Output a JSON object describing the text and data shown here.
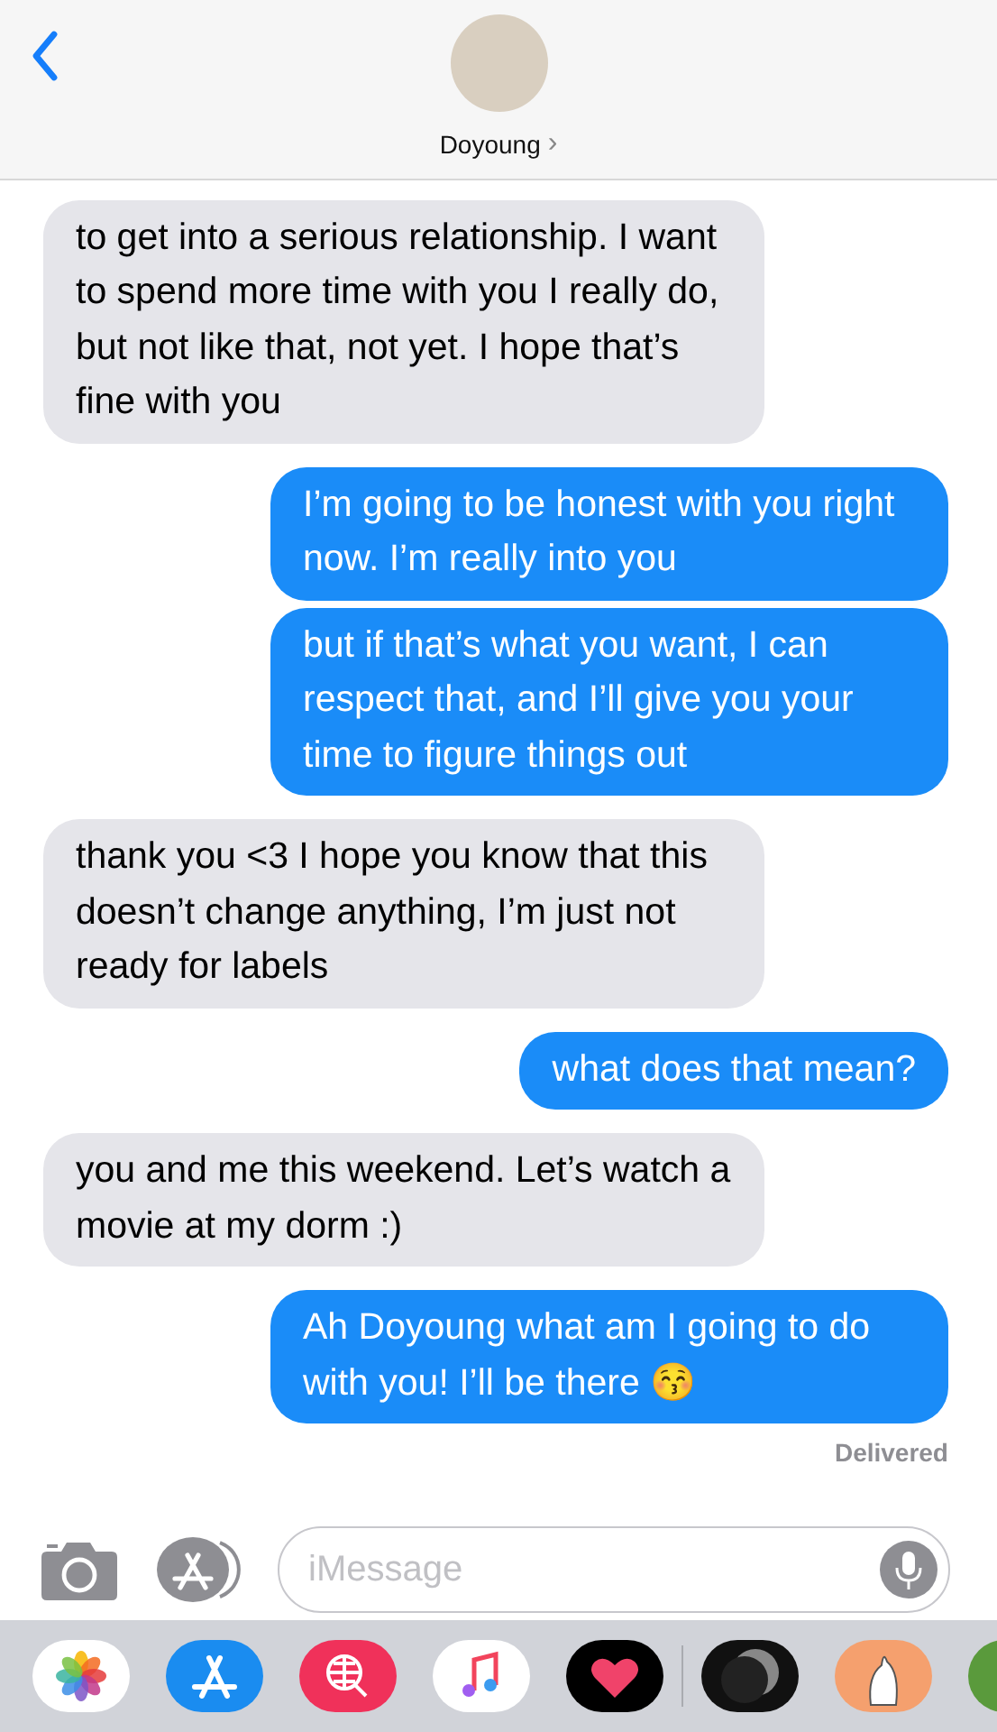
{
  "header": {
    "contact_name": "Doyoung",
    "chevron": "›"
  },
  "messages": [
    {
      "kind": "received",
      "text": "to get into a serious relationship. I want to spend more time with you I really do, but not like that, not yet. I hope that’s fine with you"
    },
    {
      "kind": "sent",
      "text": "I’m going to be honest with you right now. I’m really into you"
    },
    {
      "kind": "sent",
      "text": "but if that’s what you want, I can respect that, and I’ll give you your time to figure things out"
    },
    {
      "kind": "received",
      "text": "thank you <3 I hope you know that this doesn’t change anything, I’m just not ready for labels"
    },
    {
      "kind": "sent",
      "text": "what does that mean?"
    },
    {
      "kind": "received",
      "text": "you and me this weekend. Let’s watch a movie at my dorm :)"
    },
    {
      "kind": "sent",
      "text": "Ah Doyoung what am I going to do with you! I’ll be there 😚"
    }
  ],
  "status": "Delivered",
  "composer": {
    "placeholder": "iMessage"
  }
}
